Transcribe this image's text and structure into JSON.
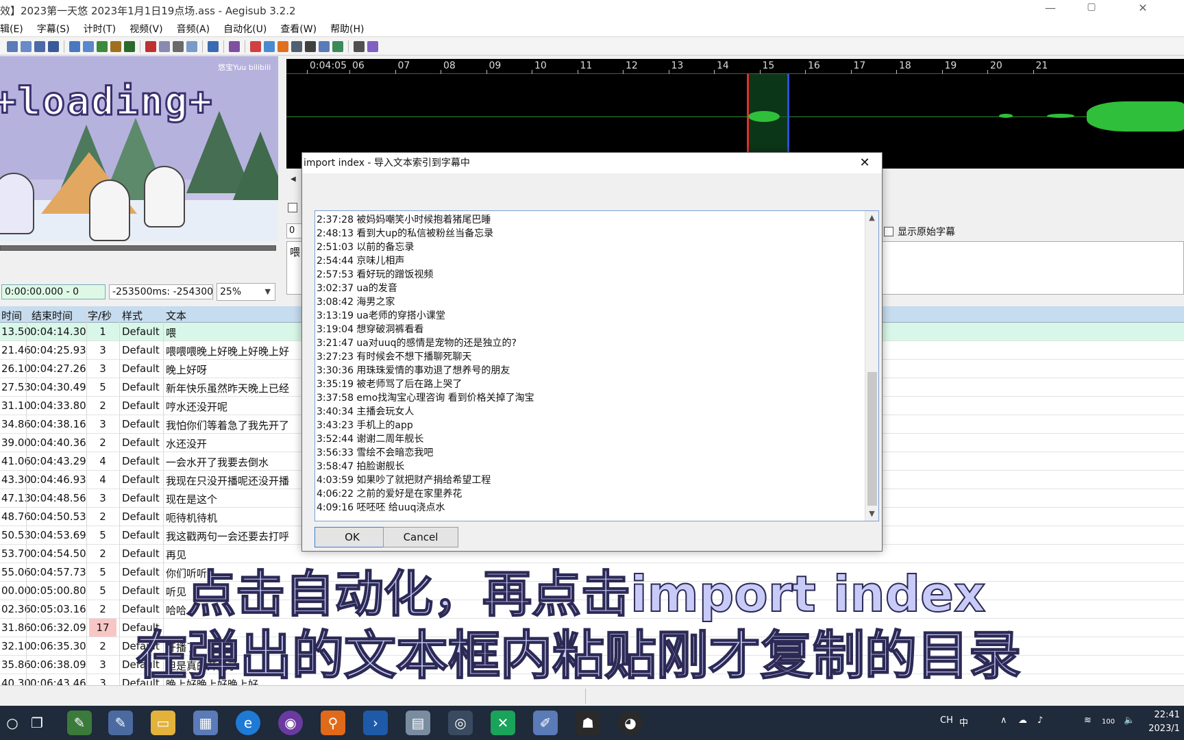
{
  "window": {
    "title": "效】2023第一天悠 2023年1月1日19点场.ass - Aegisub 3.2.2",
    "min_glyph": "—",
    "max_glyph": "▢",
    "close_glyph": "✕"
  },
  "menu": [
    "辑(E)",
    "字幕(S)",
    "计时(T)",
    "视频(V)",
    "音频(A)",
    "自动化(U)",
    "查看(W)",
    "帮助(H)"
  ],
  "video": {
    "logo_text": "+loading+",
    "brand_text": "悠宝Yuu bilibili"
  },
  "time_controls": {
    "current_time": "0:00:00.000 - 0",
    "offset": "-253500ms: -254300",
    "zoom": "25%"
  },
  "audio": {
    "ruler_ticks": [
      "0:04:05",
      "06",
      "07",
      "08",
      "09",
      "10",
      "11",
      "12",
      "13",
      "14",
      "15",
      "16",
      "17",
      "18",
      "19",
      "20",
      "21"
    ]
  },
  "edit": {
    "show_original_label": "显示原始字幕",
    "layer_value": "0",
    "edit_text_partial": "喂"
  },
  "grid": {
    "headers": {
      "start": "时间",
      "end": "结束时间",
      "cps": "字/秒",
      "style": "样式",
      "text": "文本"
    },
    "rows": [
      {
        "start": "13.50",
        "end": "0:04:14.30",
        "cps": "1",
        "style": "Default",
        "text": "喂",
        "active": true
      },
      {
        "start": "21.46",
        "end": "0:04:25.93",
        "cps": "3",
        "style": "Default",
        "text": "喂喂喂晚上好晚上好晚上好"
      },
      {
        "start": "26.10",
        "end": "0:04:27.26",
        "cps": "3",
        "style": "Default",
        "text": "晚上好呀"
      },
      {
        "start": "27.53",
        "end": "0:04:30.49",
        "cps": "5",
        "style": "Default",
        "text": "新年快乐虽然昨天晚上已经"
      },
      {
        "start": "31.10",
        "end": "0:04:33.80",
        "cps": "2",
        "style": "Default",
        "text": "哼水还没开呢"
      },
      {
        "start": "34.86",
        "end": "0:04:38.16",
        "cps": "3",
        "style": "Default",
        "text": "我怕你们等着急了我先开了"
      },
      {
        "start": "39.00",
        "end": "0:04:40.36",
        "cps": "2",
        "style": "Default",
        "text": "水还没开"
      },
      {
        "start": "41.06",
        "end": "0:04:43.29",
        "cps": "4",
        "style": "Default",
        "text": "一会水开了我要去倒水"
      },
      {
        "start": "43.30",
        "end": "0:04:46.93",
        "cps": "4",
        "style": "Default",
        "text": "我现在只没开播呢还没开播"
      },
      {
        "start": "47.13",
        "end": "0:04:48.56",
        "cps": "3",
        "style": "Default",
        "text": "现在是这个"
      },
      {
        "start": "48.76",
        "end": "0:04:50.53",
        "cps": "2",
        "style": "Default",
        "text": "呃待机待机"
      },
      {
        "start": "50.53",
        "end": "0:04:53.69",
        "cps": "5",
        "style": "Default",
        "text": "我这戳两句一会还要去打呼"
      },
      {
        "start": "53.70",
        "end": "0:04:54.50",
        "cps": "2",
        "style": "Default",
        "text": "再见"
      },
      {
        "start": "55.06",
        "end": "0:04:57.73",
        "cps": "5",
        "style": "Default",
        "text": "你们听听"
      },
      {
        "start": "00.00",
        "end": "0:05:00.80",
        "cps": "5",
        "style": "Default",
        "text": "听见"
      },
      {
        "start": "02.36",
        "end": "0:05:03.16",
        "cps": "2",
        "style": "Default",
        "text": "哈哈"
      },
      {
        "start": "31.86",
        "end": "0:06:32.09",
        "cps": "17",
        "style": "Default",
        "text": "",
        "high": true
      },
      {
        "start": "32.10",
        "end": "0:06:35.30",
        "cps": "2",
        "style": "Default",
        "text": "开播了"
      },
      {
        "start": "35.86",
        "end": "0:06:38.09",
        "cps": "3",
        "style": "Default",
        "text": "但是真的开播了"
      },
      {
        "start": "40.30",
        "end": "0:06:43.46",
        "cps": "3",
        "style": "Default",
        "text": "晚上好晚上好晚上好"
      }
    ]
  },
  "dialog": {
    "title": "import index - 导入文本索引到字幕中",
    "close_glyph": "✕",
    "lines": [
      "2:37:28 被妈妈嘲笑小时候抱着猪尾巴睡",
      "2:48:13 看到大up的私信被粉丝当备忘录",
      "2:51:03 以前的备忘录",
      "2:54:44 京味儿相声",
      "2:57:53 看好玩的蹭饭视频",
      "3:02:37 ua的发音",
      "3:08:42 海男之家",
      "3:13:19 ua老师的穿搭小课堂",
      "3:19:04 想穿破洞裤看看",
      "3:21:47 ua对uuq的感情是宠物的还是独立的?",
      "3:27:23 有时候会不想下播聊死聊天",
      "3:30:36 用珠珠爱情的事劝退了想养号的朋友",
      "3:35:19 被老师骂了后在路上哭了",
      "3:37:58 emo找淘宝心理咨询 看到价格关掉了淘宝",
      "3:40:34 主播会玩女人",
      "3:43:23 手机上的app",
      "3:52:44 谢谢二周年舰长",
      "3:56:33 雪绘不会暗恋我吧",
      "3:58:47 拍脸谢舰长",
      "4:03:59 如果吵了就把财产捐给希望工程",
      "4:06:22 之前的爱好是在家里养花",
      "4:09:16 呸呸呸 给uuq浇点水"
    ],
    "ok_label": "OK",
    "cancel_label": "Cancel"
  },
  "captions": {
    "line1": "点击自动化，再点击import index",
    "line2": "在弹出的文本框内粘贴刚才复制的目录"
  },
  "taskbar": {
    "tray_lang": "CH",
    "tray_ime": "中",
    "battery": "100",
    "clock_time": "22:41",
    "clock_date": "2023/1"
  },
  "colors": {
    "grid_header": "#c6dcef",
    "active_row": "#d9f7e8",
    "high_cps": "#f9c6c6",
    "waveform": "#2fbf3a",
    "caption_fill": "#c8caf7"
  }
}
